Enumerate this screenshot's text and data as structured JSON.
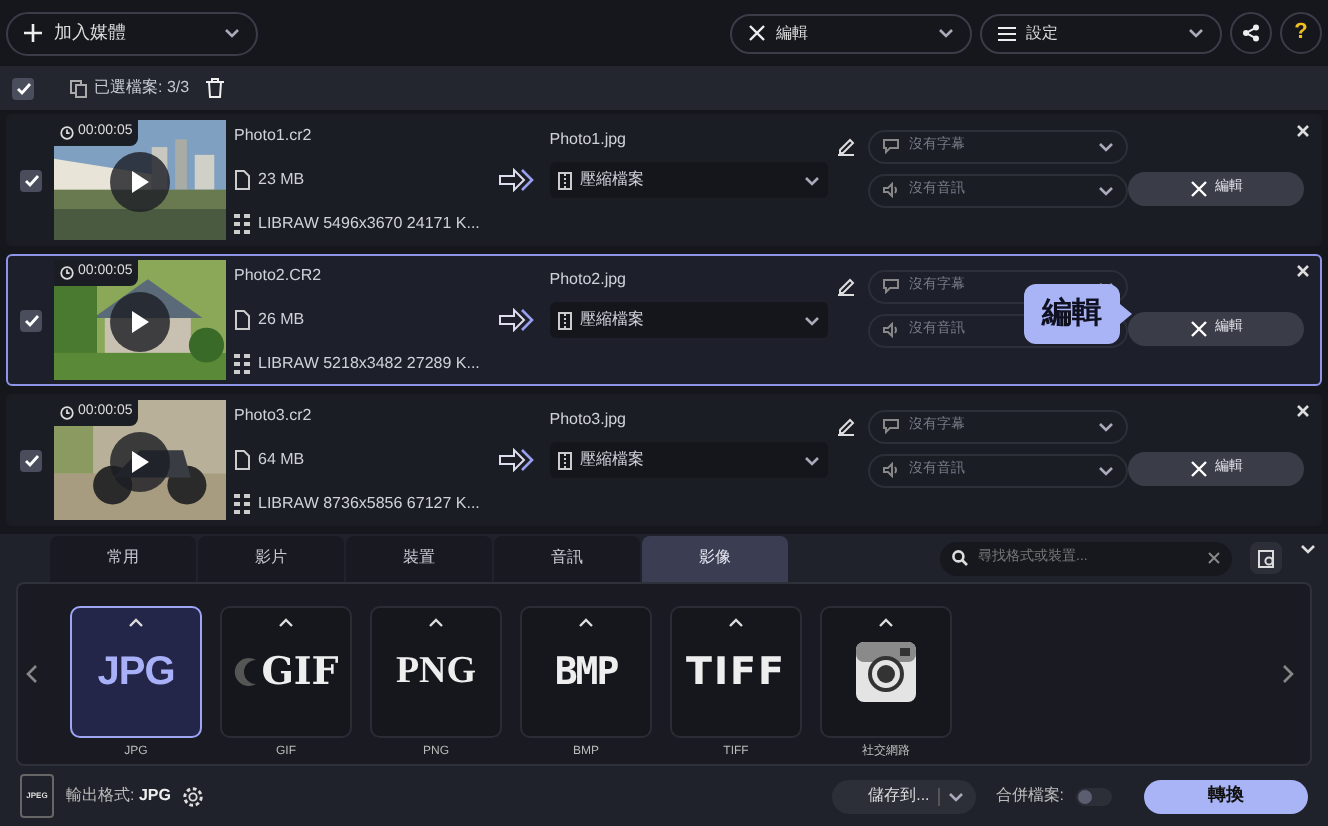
{
  "toolbar": {
    "add_media": "加入媒體",
    "edit": "編輯",
    "settings": "設定",
    "help": "?"
  },
  "selection": {
    "checked": true,
    "label": "已選檔案: 3/3"
  },
  "files": [
    {
      "checked": true,
      "selected": false,
      "duration": "00:00:05",
      "source": "Photo1.cr2",
      "size": "23 MB",
      "info": "LIBRAW 5496x3670 24171 K...",
      "output": "Photo1.jpg",
      "compression": "壓縮檔案",
      "subtitles": "沒有字幕",
      "audio": "沒有音訊",
      "edit": "編輯"
    },
    {
      "checked": true,
      "selected": true,
      "duration": "00:00:05",
      "source": "Photo2.CR2",
      "size": "26 MB",
      "info": "LIBRAW 5218x3482 27289 K...",
      "output": "Photo2.jpg",
      "compression": "壓縮檔案",
      "subtitles": "沒有字幕",
      "audio": "沒有音訊",
      "edit": "編輯",
      "tooltip": "編輯"
    },
    {
      "checked": true,
      "selected": false,
      "duration": "00:00:05",
      "source": "Photo3.cr2",
      "size": "64 MB",
      "info": "LIBRAW 8736x5856 67127 K...",
      "output": "Photo3.jpg",
      "compression": "壓縮檔案",
      "subtitles": "沒有字幕",
      "audio": "沒有音訊",
      "edit": "編輯"
    }
  ],
  "format_tabs": [
    {
      "label": "常用",
      "selected": false
    },
    {
      "label": "影片",
      "selected": false
    },
    {
      "label": "裝置",
      "selected": false
    },
    {
      "label": "音訊",
      "selected": false
    },
    {
      "label": "影像",
      "selected": true
    }
  ],
  "search": {
    "placeholder": "尋找格式或裝置..."
  },
  "formats": [
    {
      "kind": "jpg",
      "logo": "JPG",
      "label": "JPG",
      "selected": true
    },
    {
      "kind": "gif",
      "logo": "GIF",
      "label": "GIF",
      "selected": false
    },
    {
      "kind": "png",
      "logo": "PNG",
      "label": "PNG",
      "selected": false
    },
    {
      "kind": "bmp",
      "logo": "BMP",
      "label": "BMP",
      "selected": false
    },
    {
      "kind": "tiff",
      "logo": "TIFF",
      "label": "TIFF",
      "selected": false
    },
    {
      "kind": "camera",
      "label": "社交網路",
      "selected": false
    }
  ],
  "output_format": {
    "file_icon": "JPEG",
    "label": "輸出格式:",
    "value": "JPG"
  },
  "save_to": "儲存到...",
  "merge": {
    "label": "合併檔案:",
    "on": false
  },
  "convert": "轉換"
}
